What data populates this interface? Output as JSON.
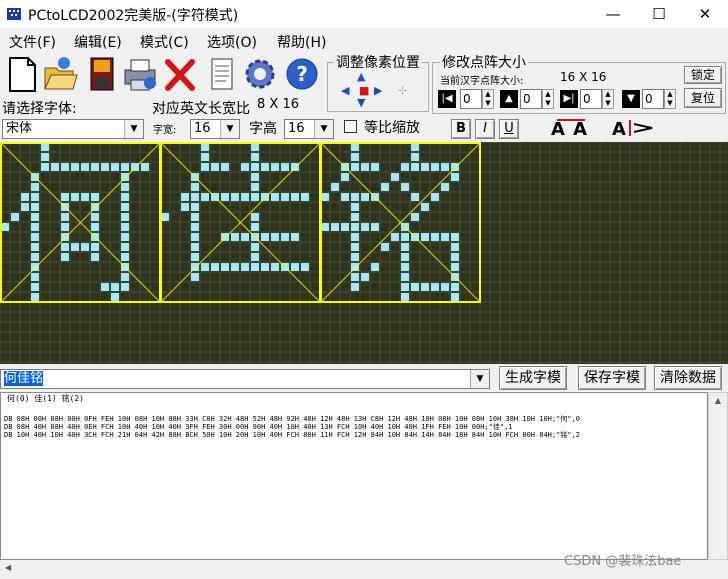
{
  "window": {
    "title": "PCtoLCD2002完美版-(字符模式)",
    "controls": {
      "minimize": "—",
      "maximize": "☐",
      "close": "✕"
    }
  },
  "menu": [
    "文件(F)",
    "编辑(E)",
    "模式(C)",
    "选项(O)",
    "帮助(H)"
  ],
  "toolbar": {
    "icons": [
      "new-file-icon",
      "open-folder-icon",
      "save-disk-icon",
      "print-icon",
      "delete-x-icon",
      "notepad-icon",
      "settings-gear-icon",
      "help-icon"
    ]
  },
  "adjust_group": {
    "label": "调整像素位置"
  },
  "resize_group": {
    "label": "修改点阵大小",
    "current_label": "当前汉字点阵大小:",
    "current_value": "16 X 16",
    "lock_button": "锁定",
    "reset_button": "复位",
    "spinners": [
      "0",
      "0",
      "0",
      "0"
    ]
  },
  "font_panel": {
    "choose_font_label": "请选择字体:",
    "ratio_label": "对应英文长宽比",
    "ratio_value": "8 X 16",
    "font_name": "宋体",
    "char_width_label": "字宽:",
    "char_width": "16",
    "char_height_label": "字高",
    "char_height": "16",
    "proportional_label": "等比缩放",
    "style_buttons": [
      "B",
      "I",
      "U"
    ]
  },
  "matrix": {
    "bg_color": "#2d331d",
    "grid_color": "#4a4f3c",
    "pixel_color": "#a6e8f5",
    "border_color": "#ffff00",
    "cell_count": 3
  },
  "bottom": {
    "input_text": "何佳铭",
    "generate_button": "生成字模",
    "save_button": "保存字模",
    "clear_button": "清除数据"
  },
  "output": {
    "header": "何(0)  佳(1)  铭(2)",
    "lines": [
      "DB 08H 00H 08H 00H 0FH FEH 10H 08H 10H 08H 33H C8H 32H 48H 52H 48H 92H 48H 12H 48H 13H C8H 12H 48H 10H 08H 10H 08H 10H 38H 10H 10H;\"何\",0",
      "DB 08H 40H 08H 40H 0EH FCH 10H 40H 10H 40H 3FH FEH 30H 00H 90H 40H 10H 40H 13H FCH 10H 40H 10H 40H 1FH FEH 10H 00H;\"佳\",1",
      "DB 10H 40H 10H 40H 3CH FCH 21H 04H 42H 88H BCH 50H 10H 20H 10H 40H FCH 80H 11H FCH 12H 84H 10H 84H 14H 84H 18H 84H 10H FCH 00H 84H;\"铭\",2"
    ]
  },
  "watermark": "CSDN @裴珠泫bae"
}
